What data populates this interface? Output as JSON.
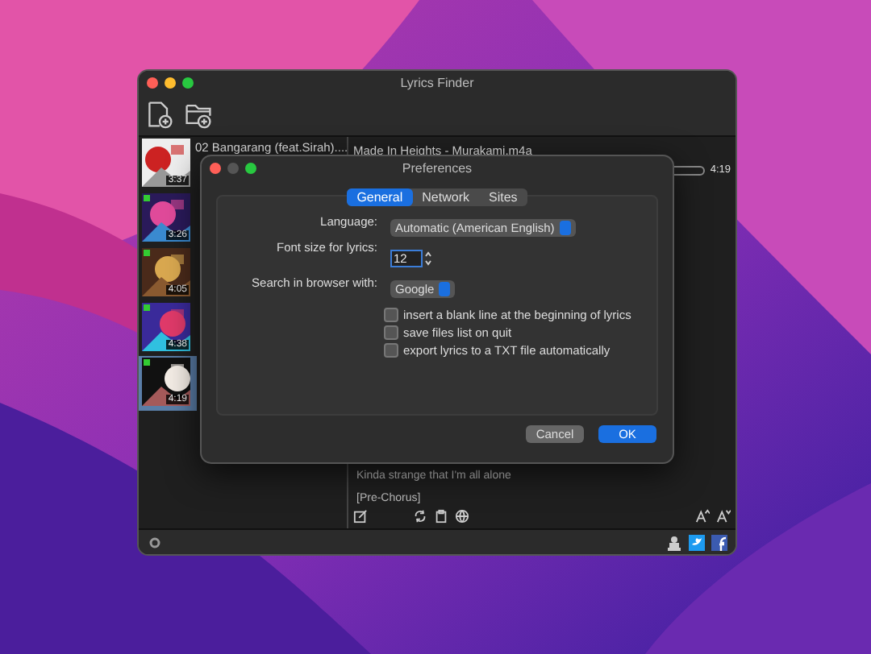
{
  "window": {
    "title": "Lyrics Finder"
  },
  "tracks": [
    {
      "title": "02 Bangarang (feat.Sirah)....",
      "duration": "3:37",
      "marked": false,
      "selected": false
    },
    {
      "duration": "3:26",
      "marked": true,
      "selected": false
    },
    {
      "duration": "4:05",
      "marked": true,
      "selected": false
    },
    {
      "duration": "4:38",
      "marked": true,
      "selected": false
    },
    {
      "duration": "4:19",
      "marked": true,
      "selected": true
    }
  ],
  "player": {
    "file": "Made In Heights - Murakami.m4a",
    "level": 0,
    "time": "4:19"
  },
  "lyrics": [
    "Kinda strange that I'm all alone",
    "[Pre-Chorus]"
  ],
  "dialog": {
    "title": "Preferences",
    "tabs": [
      {
        "label": "General",
        "selected": true
      },
      {
        "label": "Network",
        "selected": false
      },
      {
        "label": "Sites",
        "selected": false
      }
    ],
    "language": {
      "label": "Language:",
      "value": "Automatic (American English)"
    },
    "font_size": {
      "label": "Font size for lyrics:",
      "value": "12"
    },
    "browser": {
      "label": "Search in browser with:",
      "value": "Google"
    },
    "options": [
      {
        "label": "insert a blank line at the beginning of lyrics",
        "checked": false
      },
      {
        "label": "save files list on quit",
        "checked": false
      },
      {
        "label": "export lyrics to a TXT file automatically",
        "checked": false
      }
    ],
    "buttons": [
      {
        "label": "Cancel",
        "kind": "secondary"
      },
      {
        "label": "OK",
        "kind": "primary"
      }
    ]
  }
}
